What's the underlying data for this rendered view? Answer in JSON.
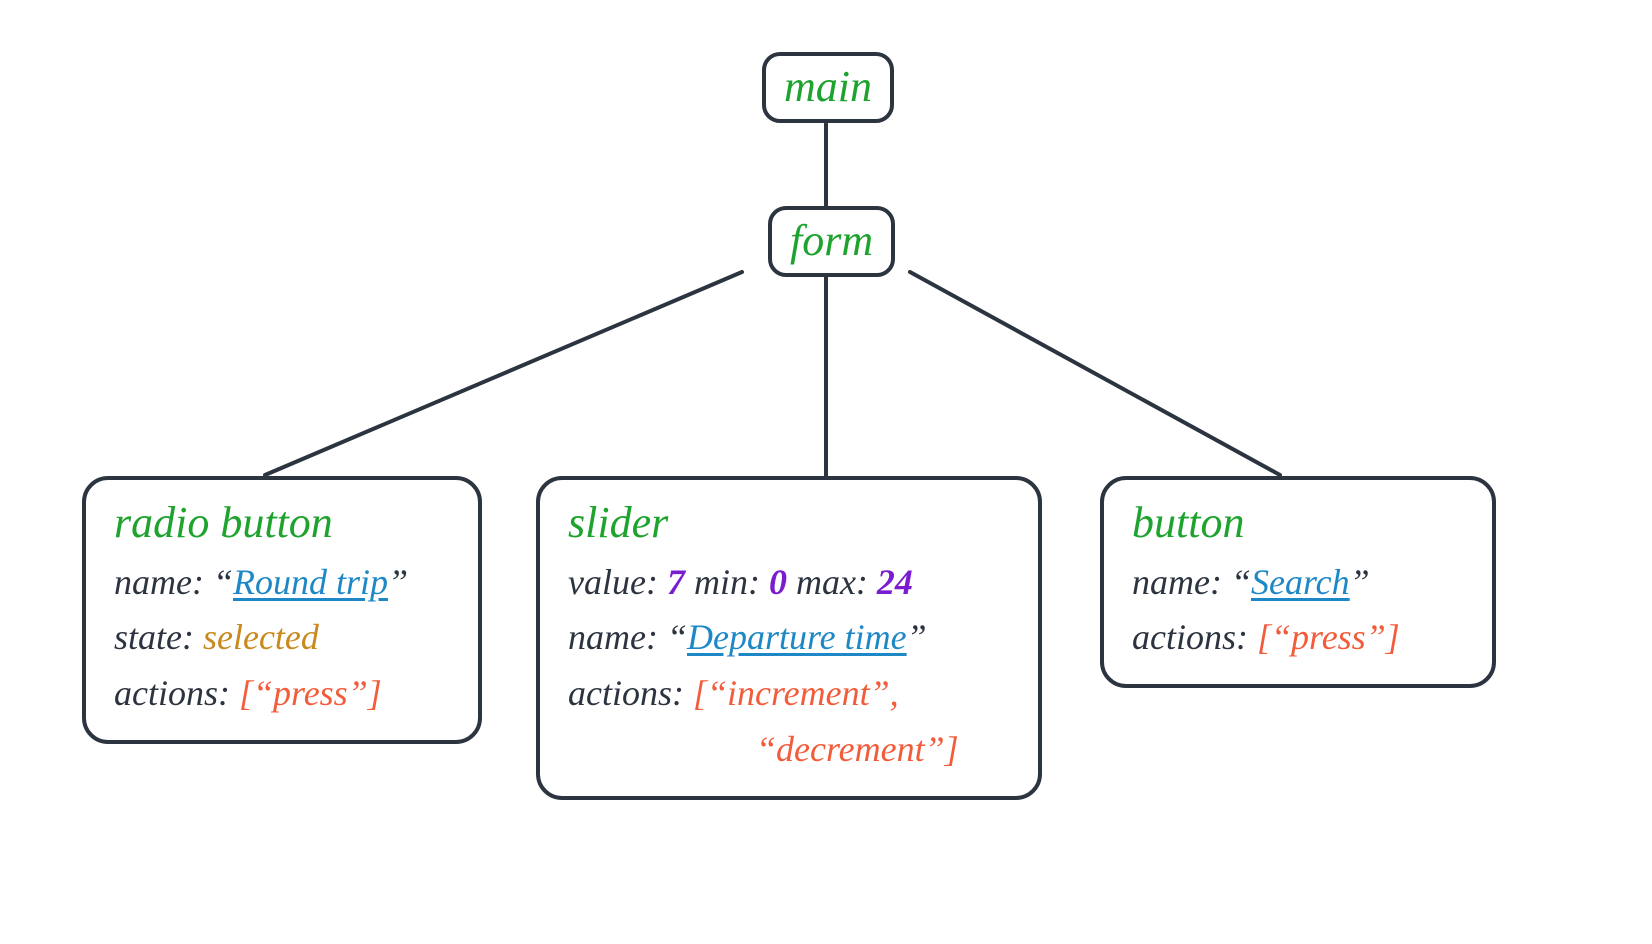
{
  "tree": {
    "root": {
      "role": "main"
    },
    "form": {
      "role": "form"
    },
    "radio": {
      "role": "radio button",
      "name_label": "name:",
      "name_value": "Round trip",
      "state_label": "state:",
      "state_value": "selected",
      "actions_label": "actions:",
      "actions_text": "[“press”]"
    },
    "slider": {
      "role": "slider",
      "value_label": "value:",
      "value": "7",
      "min_label": "min:",
      "min": "0",
      "max_label": "max:",
      "max": "24",
      "name_label": "name:",
      "name_value": "Departure time",
      "actions_label": "actions:",
      "actions_line1": "[“increment”,",
      "actions_line2": "“decrement”]"
    },
    "button": {
      "role": "button",
      "name_label": "name:",
      "name_value": "Search",
      "actions_label": "actions:",
      "actions_text": "[“press”]"
    }
  },
  "colors": {
    "role_green": "#1fa32f",
    "link_blue": "#1e88c7",
    "state_amber": "#c88a1e",
    "number_purple": "#7a1dd1",
    "action_coral": "#f25c3b",
    "border": "#2c3440"
  }
}
